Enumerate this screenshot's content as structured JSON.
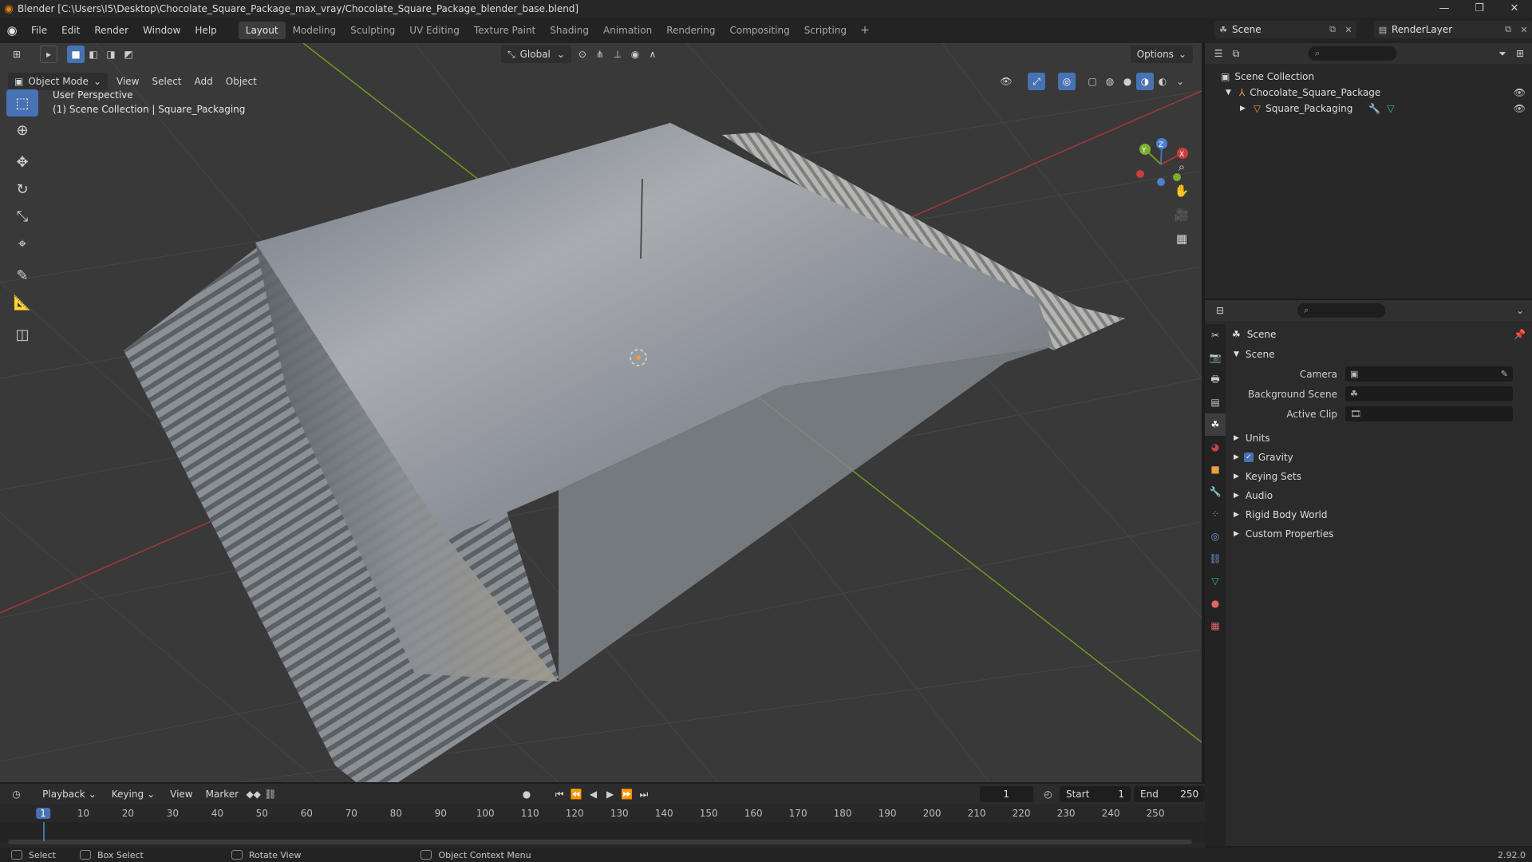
{
  "window": {
    "title": "Blender [C:\\Users\\I5\\Desktop\\Chocolate_Square_Package_max_vray/Chocolate_Square_Package_blender_base.blend]",
    "controls": [
      "—",
      "❐",
      "✕"
    ]
  },
  "menu": [
    "File",
    "Edit",
    "Render",
    "Window",
    "Help"
  ],
  "workspaces": {
    "tabs": [
      "Layout",
      "Modeling",
      "Sculpting",
      "UV Editing",
      "Texture Paint",
      "Shading",
      "Animation",
      "Rendering",
      "Compositing",
      "Scripting"
    ],
    "active": "Layout",
    "add": "+"
  },
  "scene_selector": {
    "value": "Scene"
  },
  "layer_selector": {
    "value": "RenderLayer"
  },
  "viewport_header": {
    "mode": "Object Mode",
    "menus": [
      "View",
      "Select",
      "Add",
      "Object"
    ],
    "transform_orientation": "Global",
    "options": "Options"
  },
  "viewport_info": {
    "line1": "User Perspective",
    "line2": "(1) Scene Collection | Square_Packaging"
  },
  "gizmo": {
    "x": "X",
    "y": "Y",
    "z": "Z"
  },
  "outliner": {
    "root": "Scene Collection",
    "items": [
      {
        "label": "Chocolate_Square_Package"
      },
      {
        "label": "Square_Packaging"
      }
    ]
  },
  "properties": {
    "breadcrumb": "Scene",
    "panel_title": "Scene",
    "fields": [
      {
        "label": "Camera"
      },
      {
        "label": "Background Scene"
      },
      {
        "label": "Active Clip"
      }
    ],
    "panels": [
      "Units",
      "Gravity",
      "Keying Sets",
      "Audio",
      "Rigid Body World",
      "Custom Properties"
    ],
    "gravity_checked": true
  },
  "timeline": {
    "menus": [
      "Playback",
      "Keying",
      "View",
      "Marker"
    ],
    "current_frame": "1",
    "start_label": "Start",
    "start": "1",
    "end_label": "End",
    "end": "250",
    "ticks": [
      "1",
      "10",
      "20",
      "30",
      "40",
      "50",
      "60",
      "70",
      "80",
      "90",
      "100",
      "110",
      "120",
      "130",
      "140",
      "150",
      "160",
      "170",
      "180",
      "190",
      "200",
      "210",
      "220",
      "230",
      "240",
      "250"
    ]
  },
  "statusbar": {
    "select": "Select",
    "box_select": "Box Select",
    "rotate": "Rotate View",
    "context_menu": "Object Context Menu",
    "version": "2.92.0"
  },
  "colors": {
    "accent": "#4772b3",
    "axis_x": "#a33838",
    "axis_y": "#6f9a22",
    "object_origin": "#e8a040"
  }
}
